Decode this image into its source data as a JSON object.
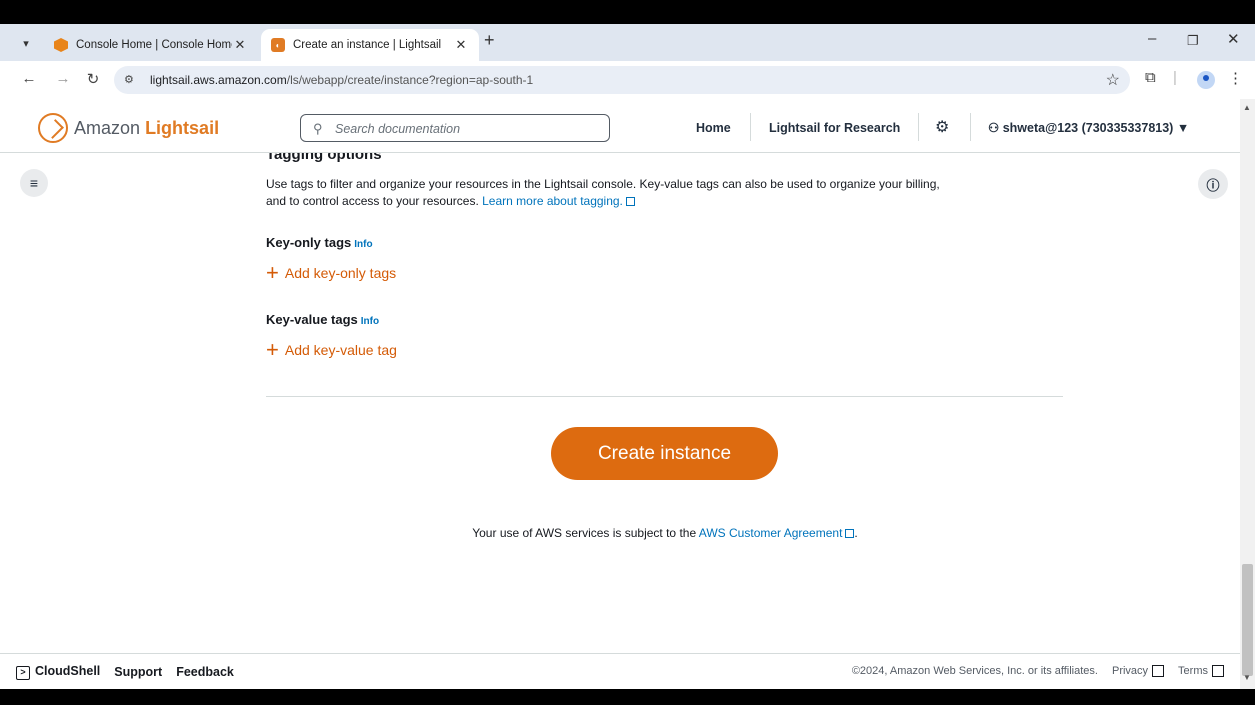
{
  "browser": {
    "tabs": [
      {
        "title": "Console Home | Console Home",
        "active": false,
        "icon": "aws-console-favicon"
      },
      {
        "title": "Create an instance | Lightsail",
        "active": true,
        "icon": "lightsail-favicon"
      }
    ],
    "url_domain": "lightsail.aws.amazon.com",
    "url_path": "/ls/webapp/create/instance?region=ap-south-1"
  },
  "header": {
    "logo_prefix": "Amazon",
    "logo_brand": "Lightsail",
    "search_placeholder": "Search documentation",
    "nav_home": "Home",
    "nav_research": "Lightsail for Research",
    "user_label": "shweta@123 (730335337813)",
    "user_caret": "▼"
  },
  "tagging": {
    "title": "Tagging options",
    "description": "Use tags to filter and organize your resources in the Lightsail console. Key-value tags can also be used to organize your billing, and to control access to your resources.",
    "learn_more": "Learn more about tagging.",
    "key_only_title": "Key-only tags",
    "key_only_info": "Info",
    "key_only_add": "Add key-only tags",
    "key_value_title": "Key-value tags",
    "key_value_info": "Info",
    "key_value_add": "Add key-value tag"
  },
  "actions": {
    "create_button": "Create instance"
  },
  "agreement": {
    "prefix": "Your use of AWS services is subject to the",
    "link": "AWS Customer Agreement",
    "suffix": "."
  },
  "footer": {
    "cloudshell": "CloudShell",
    "support": "Support",
    "feedback": "Feedback",
    "copyright": "©2024, Amazon Web Services, Inc. or its affiliates.",
    "privacy": "Privacy",
    "terms": "Terms"
  },
  "colors": {
    "accent_orange": "#dd6b10",
    "link_blue": "#0073bb"
  }
}
